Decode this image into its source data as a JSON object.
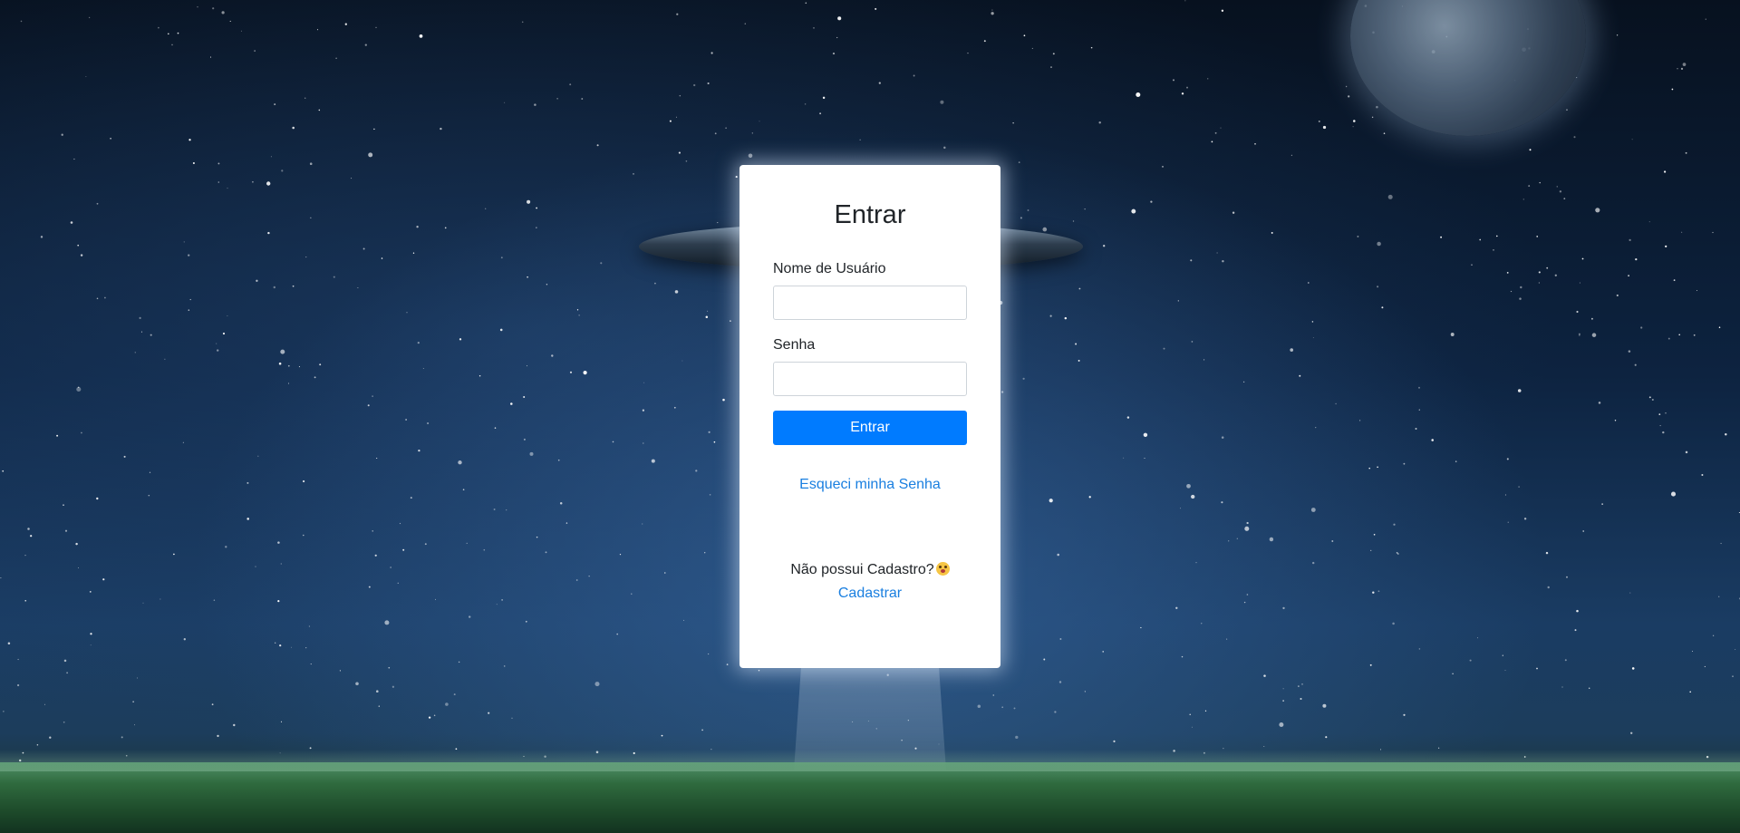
{
  "login_card": {
    "title": "Entrar",
    "username_label": "Nome de Usuário",
    "username_value": "",
    "password_label": "Senha",
    "password_value": "",
    "submit_label": "Entrar",
    "forgot_password_link": "Esqueci minha Senha",
    "signup_prompt": "Não possui Cadastro?",
    "signup_prompt_emoji": "flushed-face-emoji",
    "signup_link": "Cadastrar"
  },
  "background": {
    "scene": "night-sky-with-ufo-planet-and-grass"
  },
  "colors": {
    "primary": "#007bff",
    "link": "#1a7fe0",
    "text": "#212529",
    "card_bg": "#ffffff"
  }
}
